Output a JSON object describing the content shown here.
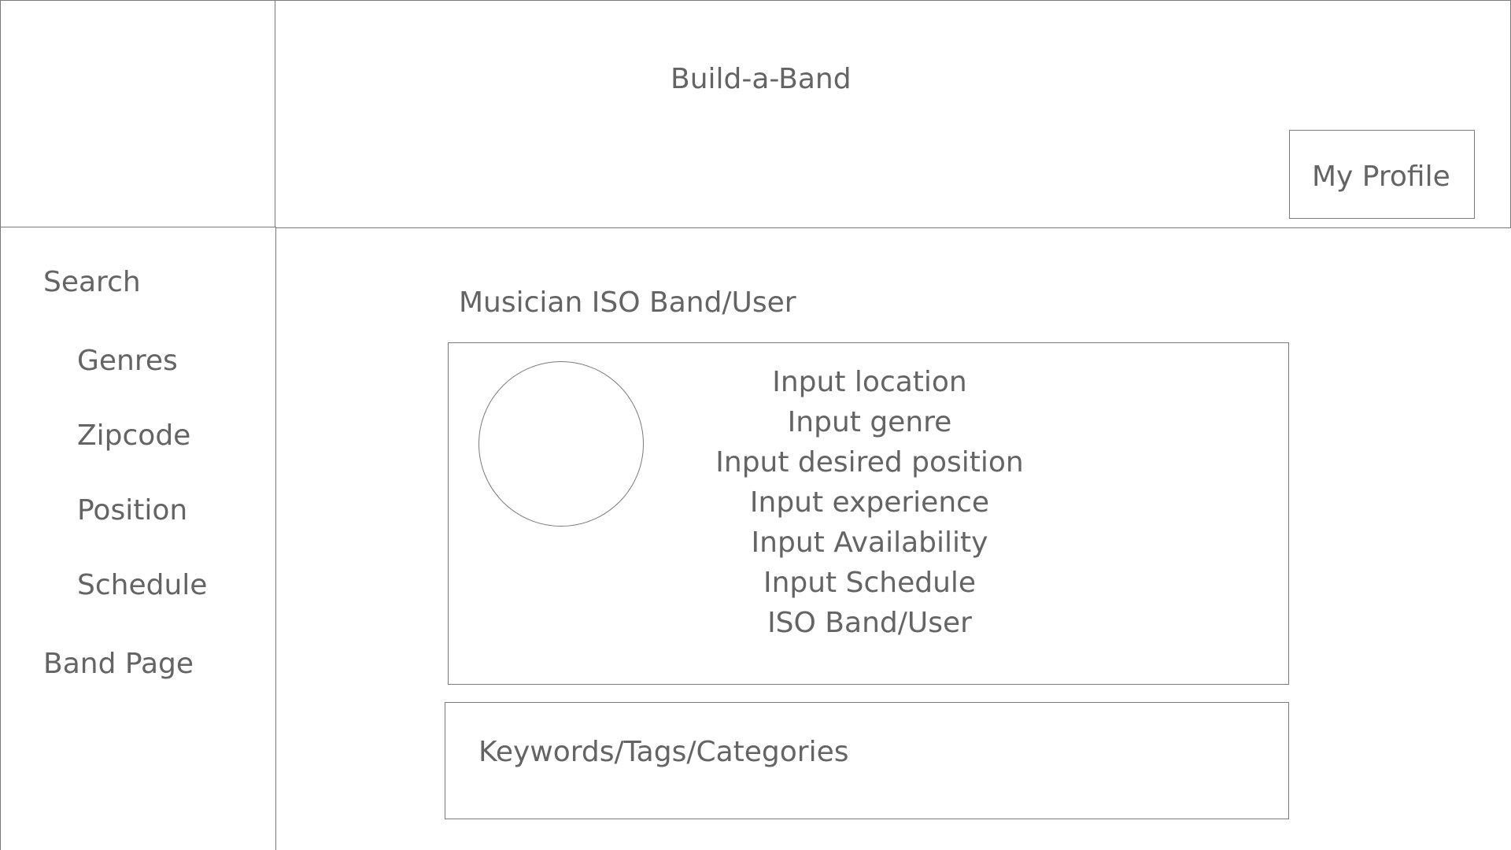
{
  "header": {
    "app_title": "Build-a-Band",
    "profile_button_label": "My Profile"
  },
  "sidebar": {
    "search_label": "Search",
    "filters": [
      {
        "label": "Genres"
      },
      {
        "label": "Zipcode"
      },
      {
        "label": "Position"
      },
      {
        "label": "Schedule"
      }
    ],
    "band_page_label": "Band Page"
  },
  "main": {
    "section_title": "Musician ISO Band/User",
    "profile_card": {
      "fields": [
        "Input location",
        "Input genre",
        "Input desired position",
        "Input experience",
        "Input Availability",
        "Input Schedule",
        "ISO Band/User"
      ]
    },
    "tags_label": "Keywords/Tags/Categories"
  }
}
